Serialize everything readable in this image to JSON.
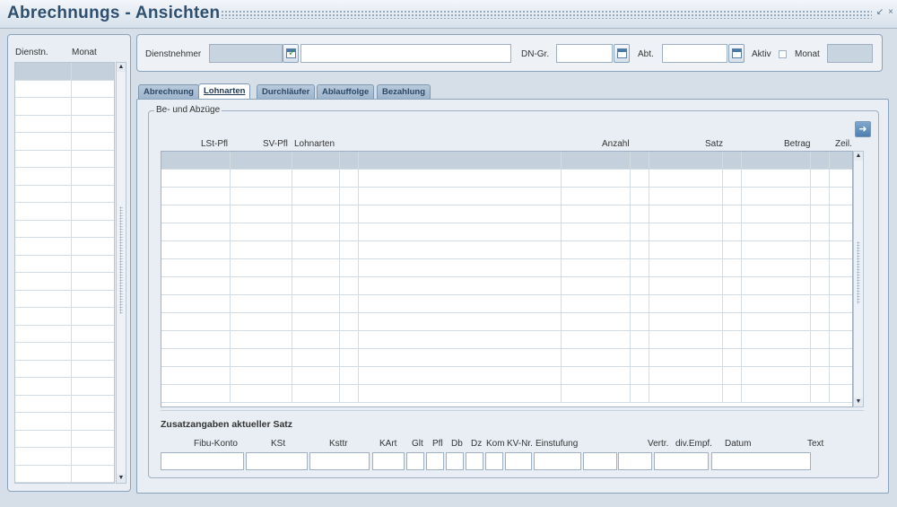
{
  "window": {
    "title": "Abrechnungs - Ansichten",
    "minimize_icon": "minimize-icon",
    "close_icon": "close-icon"
  },
  "left_panel": {
    "headers": [
      "Dienstn.",
      "Monat"
    ]
  },
  "filter": {
    "dienstnehmer_label": "Dienstnehmer",
    "dn_gr_label": "DN-Gr.",
    "abt_label": "Abt.",
    "aktiv_label": "Aktiv",
    "monat_label": "Monat",
    "dienstnehmer_value": "",
    "dienstnehmer_name": "",
    "dn_gr_value": "",
    "abt_value": "",
    "monat_value": ""
  },
  "tabs": [
    {
      "label": "Abrechnung",
      "active": false
    },
    {
      "label": "Lohnarten",
      "active": true
    },
    {
      "label": "Durchläufer",
      "active": false
    },
    {
      "label": "Ablauffolge",
      "active": false
    },
    {
      "label": "Bezahlung",
      "active": false
    }
  ],
  "group": {
    "title": "Be- und Abzüge",
    "columns": [
      "LSt-Pfl",
      "SV-Pfl",
      "Lohnarten",
      "Anzahl",
      "Satz",
      "Betrag",
      "Zeil."
    ]
  },
  "zusatz": {
    "title": "Zusatzangaben aktueller Satz",
    "columns": [
      "Fibu-Konto",
      "KSt",
      "Ksttr",
      "KArt",
      "Glt",
      "Pfl",
      "Db",
      "Dz",
      "Kom",
      "KV-Nr.",
      "Einstufung",
      "Vertr.",
      "div.Empf.",
      "Datum",
      "Text"
    ]
  }
}
